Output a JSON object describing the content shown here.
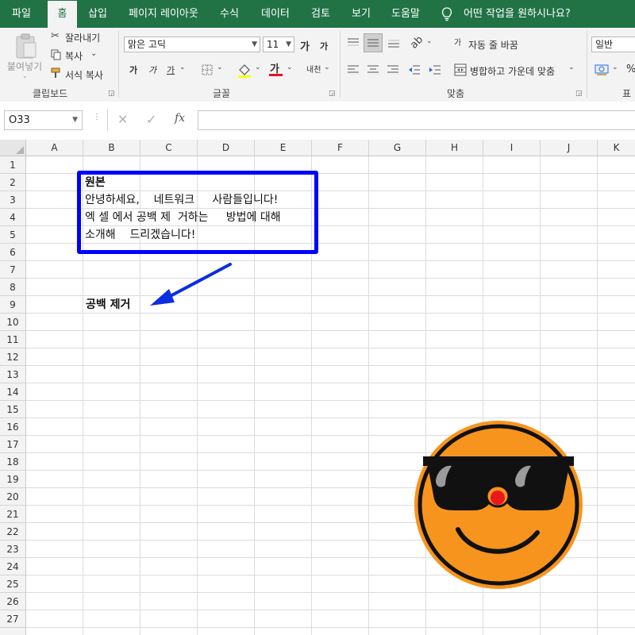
{
  "menu": {
    "tabs": [
      {
        "label": "파일"
      },
      {
        "label": "홈"
      },
      {
        "label": "삽입"
      },
      {
        "label": "페이지 레이아웃"
      },
      {
        "label": "수식"
      },
      {
        "label": "데이터"
      },
      {
        "label": "검토"
      },
      {
        "label": "보기"
      },
      {
        "label": "도움말"
      }
    ],
    "active_tab": "홈",
    "tell_me": "어떤 작업을 원하시나요?"
  },
  "ribbon": {
    "clipboard": {
      "paste": "붙여넣기",
      "cut": "잘라내기",
      "copy": "복사",
      "format_painter": "서식 복사",
      "label": "클립보드"
    },
    "font": {
      "name": "맑은 고딕",
      "size": "11",
      "grow": "가",
      "shrink": "가",
      "bold": "가",
      "italic": "가",
      "underline": "가",
      "color_glyph": "가",
      "phonetic": "내천",
      "label": "글꼴"
    },
    "alignment": {
      "wrap_text": "자동 줄 바꿈",
      "merge_center": "병합하고 가운데 맞춤",
      "label": "맞춤"
    },
    "number": {
      "format": "일반",
      "percent": "%",
      "label": "표시"
    }
  },
  "formula_bar": {
    "name_box": "O33",
    "formula": ""
  },
  "grid": {
    "columns": [
      "A",
      "B",
      "C",
      "D",
      "E",
      "F",
      "G",
      "H",
      "I",
      "J",
      "K"
    ],
    "rows": [
      "1",
      "2",
      "3",
      "4",
      "5",
      "6",
      "7",
      "8",
      "9",
      "10",
      "11",
      "12",
      "13",
      "14",
      "15",
      "16",
      "17",
      "18",
      "19",
      "20",
      "21",
      "22",
      "23",
      "24",
      "25",
      "26",
      "27"
    ]
  },
  "sheet": {
    "box_title": "원본",
    "box_lines": [
      "안녕하세요,    네트워크     사람들입니다!",
      "엑 셀 에서 공백 제  거하는     방법에 대해",
      "소개해    드리겠습니다!"
    ],
    "result_label": "공백 제거"
  },
  "colors": {
    "excel_green": "#217346",
    "box_border": "#0000ff",
    "arrow": "#0b2ee0",
    "emoji_face": "#f7941d",
    "emoji_nose": "#e8181c"
  }
}
